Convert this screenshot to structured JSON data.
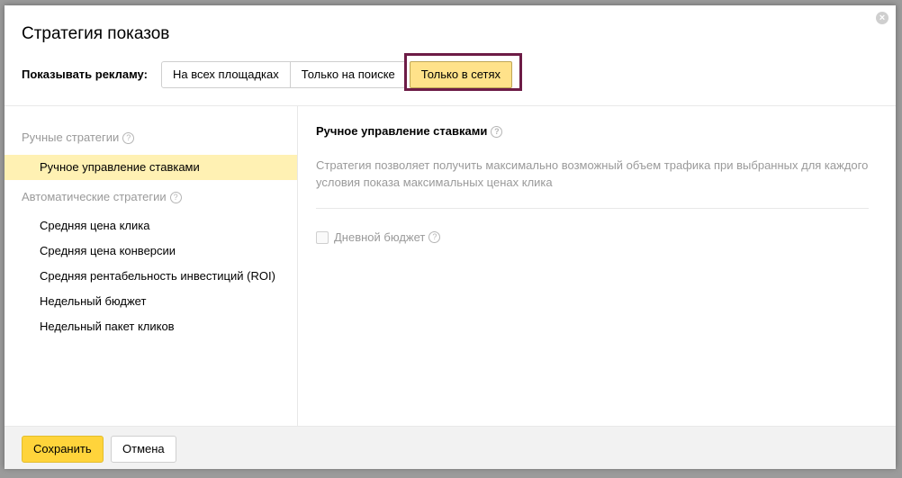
{
  "modal": {
    "title": "Стратегия показов",
    "close_icon": "close-icon"
  },
  "show_ads": {
    "label": "Показывать рекламу:",
    "tabs": [
      {
        "label": "На всех площадках"
      },
      {
        "label": "Только на поиске"
      },
      {
        "label": "Только в сетях",
        "active": true
      }
    ]
  },
  "sidebar": {
    "manual_group": {
      "label": "Ручные стратегии"
    },
    "manual_items": [
      {
        "label": "Ручное управление ставками",
        "selected": true
      }
    ],
    "auto_group": {
      "label": "Автоматические стратегии"
    },
    "auto_items": [
      {
        "label": "Средняя цена клика"
      },
      {
        "label": "Средняя цена конверсии"
      },
      {
        "label": "Средняя рентабельность инвестиций (ROI)"
      },
      {
        "label": "Недельный бюджет"
      },
      {
        "label": "Недельный пакет кликов"
      }
    ]
  },
  "content": {
    "title": "Ручное управление ставками",
    "description": "Стратегия позволяет получить максимально возможный объем трафика при выбранных для каждого условия показа максимальных ценах клика",
    "daily_budget": {
      "label": "Дневной бюджет",
      "checked": false
    }
  },
  "footer": {
    "save_label": "Сохранить",
    "cancel_label": "Отмена"
  },
  "help_glyph": "?",
  "close_glyph": "×",
  "colors": {
    "accent_yellow": "#ffd43b",
    "selected_bg": "#fff1b3",
    "highlight_border": "#6d1c46"
  }
}
